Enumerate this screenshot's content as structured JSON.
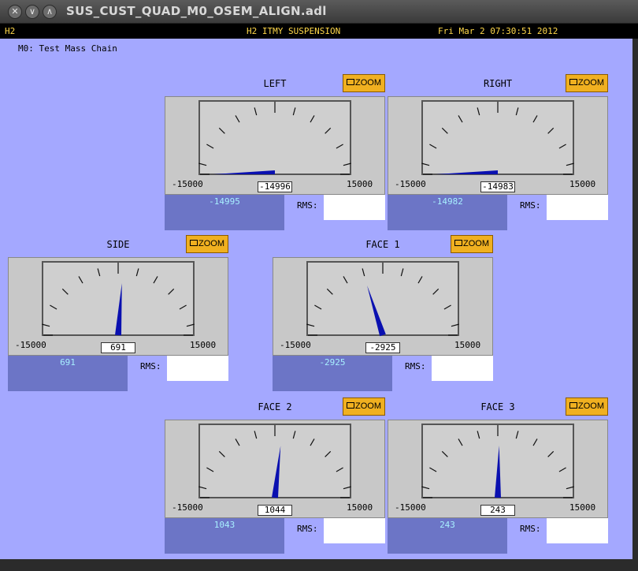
{
  "window": {
    "title": "SUS_CUST_QUAD_M0_OSEM_ALIGN.adl",
    "buttons": [
      "✕",
      "∨",
      "∧"
    ]
  },
  "header": {
    "site": "H2",
    "system": "H2 ITMY SUSPENSION",
    "datetime": "Fri Mar  2 07:30:51 2012"
  },
  "subtitle": "M0: Test Mass Chain",
  "colors": {
    "panel_bg": "#a4a8ff",
    "needle": "#0a10b0",
    "zoom_button": "#f0b020",
    "value_box": "#6c75c6",
    "value_text": "#a8f0ff",
    "header_text": "#ffd84a"
  },
  "meters": [
    {
      "id": "left",
      "title": "LEFT",
      "zoom_label": "ZOOM",
      "min_label": "-15000",
      "max_label": "15000",
      "min": -15000,
      "max": 15000,
      "readout": "-14996",
      "value": -14996,
      "value_text": "-14995",
      "rms_label": "RMS:",
      "rms_value": ""
    },
    {
      "id": "right",
      "title": "RIGHT",
      "zoom_label": "ZOOM",
      "min_label": "-15000",
      "max_label": "15000",
      "min": -15000,
      "max": 15000,
      "readout": "-14983",
      "value": -14983,
      "value_text": "-14982",
      "rms_label": "RMS:",
      "rms_value": ""
    },
    {
      "id": "side",
      "title": "SIDE",
      "zoom_label": "ZOOM",
      "min_label": "-15000",
      "max_label": "15000",
      "min": -15000,
      "max": 15000,
      "readout": "691",
      "value": 691,
      "value_text": "691",
      "rms_label": "RMS:",
      "rms_value": ""
    },
    {
      "id": "face1",
      "title": "FACE 1",
      "zoom_label": "ZOOM",
      "min_label": "-15000",
      "max_label": "15000",
      "min": -15000,
      "max": 15000,
      "readout": "-2925",
      "value": -2925,
      "value_text": "-2925",
      "rms_label": "RMS:",
      "rms_value": ""
    },
    {
      "id": "face2",
      "title": "FACE 2",
      "zoom_label": "ZOOM",
      "min_label": "-15000",
      "max_label": "15000",
      "min": -15000,
      "max": 15000,
      "readout": "1044",
      "value": 1044,
      "value_text": "1043",
      "rms_label": "RMS:",
      "rms_value": ""
    },
    {
      "id": "face3",
      "title": "FACE 3",
      "zoom_label": "ZOOM",
      "min_label": "-15000",
      "max_label": "15000",
      "min": -15000,
      "max": 15000,
      "readout": "243",
      "value": 243,
      "value_text": "243",
      "rms_label": "RMS:",
      "rms_value": ""
    }
  ]
}
